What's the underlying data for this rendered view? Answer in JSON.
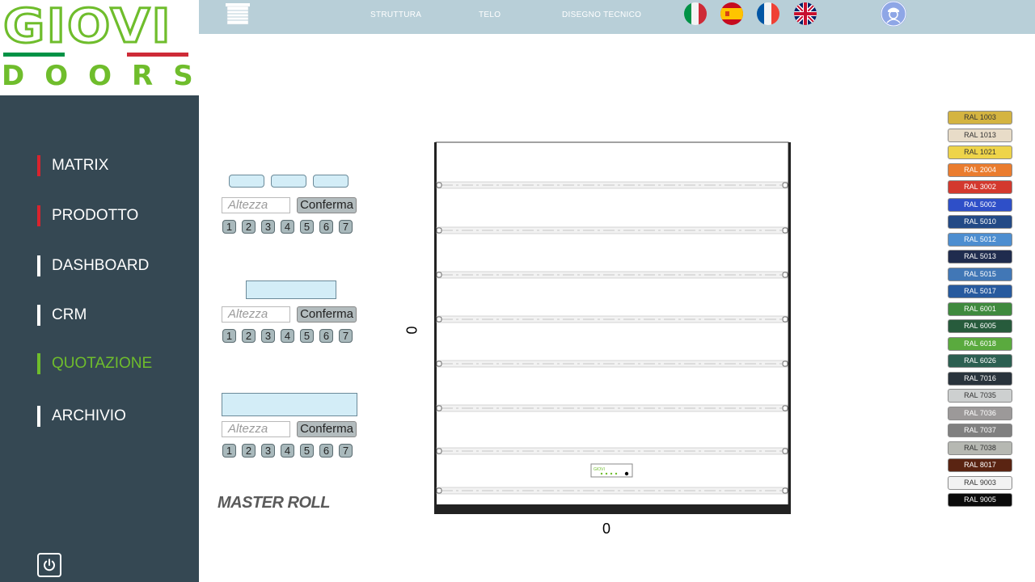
{
  "logo": {
    "brand": "GIOVI",
    "sub": "DOORS"
  },
  "sidebar": {
    "items": [
      {
        "label": "MATRIX",
        "bar_color": "#d9232d"
      },
      {
        "label": "PRODOTTO",
        "bar_color": "#d9232d"
      },
      {
        "label": "DASHBOARD",
        "bar_color": "#ffffff"
      },
      {
        "label": "CRM",
        "bar_color": "#ffffff"
      },
      {
        "label": "QUOTAZIONE",
        "bar_color": "#6fbd2c",
        "active": true
      },
      {
        "label": "ARCHIVIO",
        "bar_color": "#ffffff"
      }
    ],
    "power_icon": "power-icon"
  },
  "topbar": {
    "links": [
      "STRUTTURA",
      "TELO",
      "DISEGNO TECNICO"
    ],
    "flags": [
      "italy-flag-icon",
      "spain-flag-icon",
      "france-flag-icon",
      "uk-flag-icon"
    ],
    "user_icon": "user-avatar-icon"
  },
  "controls": {
    "altezza_placeholder": "Altezza",
    "conferma_label": "Conferma",
    "numbers": [
      "1",
      "2",
      "3",
      "4",
      "5",
      "6",
      "7"
    ]
  },
  "master_roll_label": "MASTER ROLL",
  "drawing": {
    "width_value": "0",
    "height_value": "0"
  },
  "colors": {
    "accent_green": "#6fbd2c",
    "sidebar_bg": "#354853",
    "topbar_bg": "#b8cfd8"
  },
  "swatches": [
    {
      "label": "RAL 1003",
      "color": "#d4b441",
      "text": "#333333"
    },
    {
      "label": "RAL 1013",
      "color": "#e8dcc8",
      "text": "#333333"
    },
    {
      "label": "RAL 1021",
      "color": "#eed44a",
      "text": "#333333"
    },
    {
      "label": "RAL 2004",
      "color": "#ea7c2e",
      "text": "#ffffff"
    },
    {
      "label": "RAL 3002",
      "color": "#d3392e",
      "text": "#ffffff"
    },
    {
      "label": "RAL 5002",
      "color": "#2e4fc8",
      "text": "#ffffff"
    },
    {
      "label": "RAL 5010",
      "color": "#234a86",
      "text": "#ffffff"
    },
    {
      "label": "RAL 5012",
      "color": "#4d8ed0",
      "text": "#ffffff"
    },
    {
      "label": "RAL 5013",
      "color": "#1f2c4e",
      "text": "#ffffff"
    },
    {
      "label": "RAL 5015",
      "color": "#4177b6",
      "text": "#ffffff"
    },
    {
      "label": "RAL 5017",
      "color": "#275a9e",
      "text": "#ffffff"
    },
    {
      "label": "RAL 6001",
      "color": "#3f8a3e",
      "text": "#ffffff"
    },
    {
      "label": "RAL 6005",
      "color": "#275b3c",
      "text": "#ffffff"
    },
    {
      "label": "RAL 6018",
      "color": "#5aaa3e",
      "text": "#ffffff"
    },
    {
      "label": "RAL 6026",
      "color": "#2c5f51",
      "text": "#ffffff"
    },
    {
      "label": "RAL 7016",
      "color": "#29333c",
      "text": "#ffffff"
    },
    {
      "label": "RAL 7035",
      "color": "#cdd0d0",
      "text": "#333333"
    },
    {
      "label": "RAL 7036",
      "color": "#9c9999",
      "text": "#ffffff"
    },
    {
      "label": "RAL 7037",
      "color": "#808080",
      "text": "#ffffff"
    },
    {
      "label": "RAL 7038",
      "color": "#b6b8b2",
      "text": "#333333"
    },
    {
      "label": "RAL 8017",
      "color": "#5a2412",
      "text": "#ffffff"
    },
    {
      "label": "RAL 9003",
      "color": "#f2f2f2",
      "text": "#333333"
    },
    {
      "label": "RAL 9005",
      "color": "#0b0b0b",
      "text": "#ffffff"
    }
  ]
}
